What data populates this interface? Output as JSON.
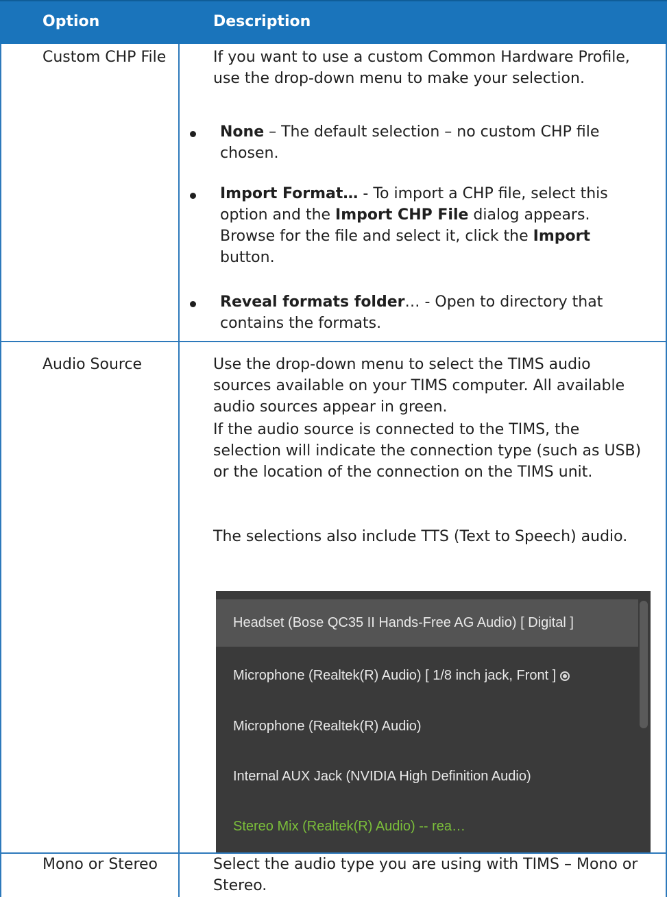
{
  "header": {
    "option": "Option",
    "description": "Description"
  },
  "rows": [
    {
      "option": "Custom CHP File",
      "intro": "If you want to use a custom Common Hardware Profile, use the drop-down menu to make your selection.",
      "bullets": [
        {
          "bold": "None",
          "rest": " – The default selection – no custom CHP file chosen."
        },
        {
          "bold": "Import Format…",
          "rest_a": " - To import a CHP file, select this option and the ",
          "bold_b": "Import CHP File",
          "rest_b": " dialog appears. Browse for the file and select it, click the ",
          "bold_c": "Import",
          "rest_c": " button."
        },
        {
          "bold": "Reveal formats folder",
          "rest": "… - Open to directory that contains the formats."
        }
      ]
    },
    {
      "option": "Audio Source",
      "p1": "Use the drop-down menu to select the TIMS audio sources available on your TIMS computer. All available audio sources appear in green.",
      "p2": "If the audio source is connected to the TIMS, the selection will indicate the connection type (such as USB) or the location of the connection on the TIMS unit.",
      "p3": "The selections also include TTS (Text to Speech) audio."
    },
    {
      "option": "Mono or Stereo",
      "desc": "Select the audio type you are using with TIMS – Mono or Stereo."
    }
  ],
  "dropdown": {
    "items": [
      "Headset (Bose QC35 II Hands-Free AG Audio) [ Digital ]",
      "Microphone (Realtek(R) Audio) [ 1/8 inch jack, Front ]",
      "Microphone (Realtek(R) Audio)",
      "Internal AUX Jack (NVIDIA High Definition Audio)",
      "Stereo Mix (Realtek(R) Audio) -- rea…"
    ],
    "selected_index": 1,
    "hover_index": 0,
    "available_color": "#7bbf3a"
  }
}
